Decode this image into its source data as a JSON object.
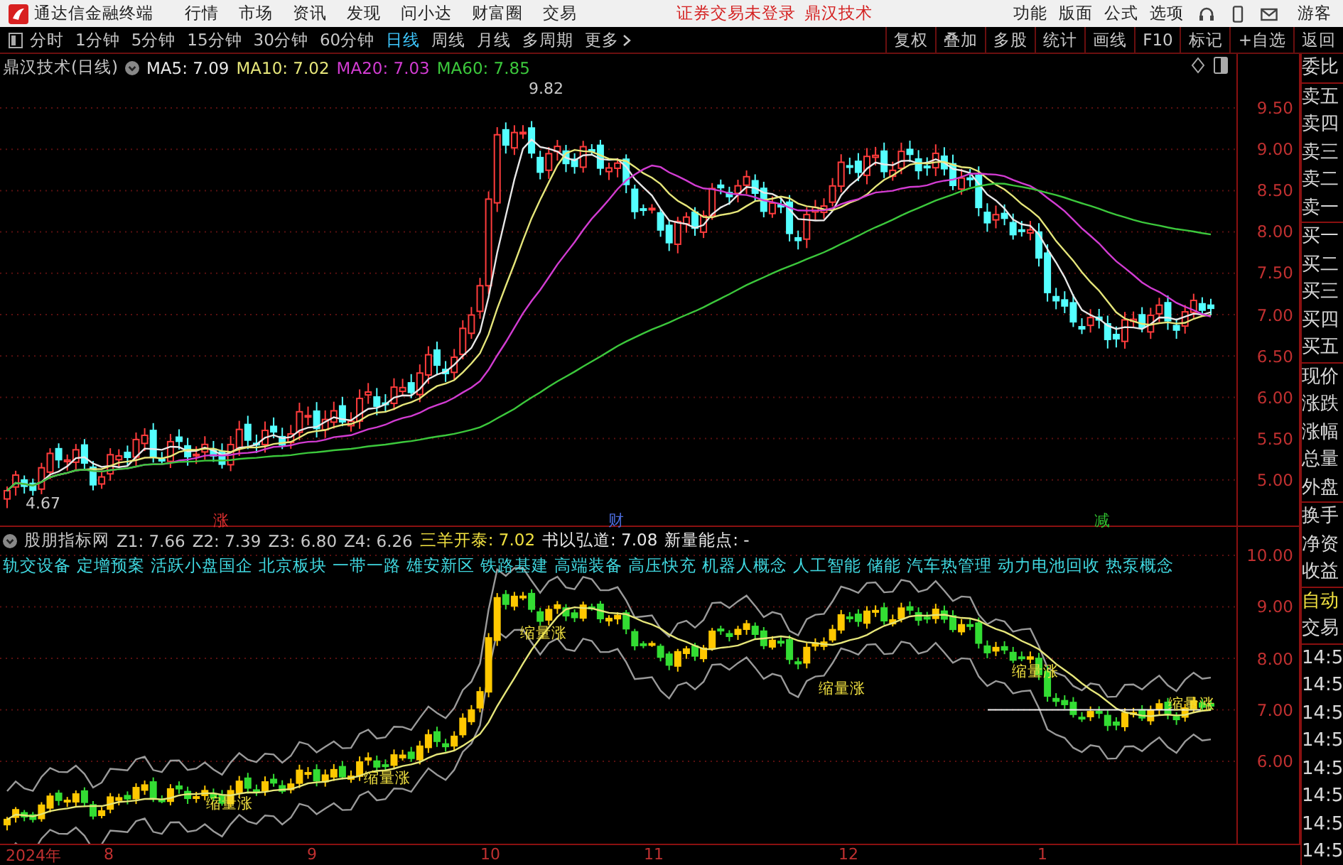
{
  "menu_bar": {
    "app_title": "通达信金融终端",
    "menus": [
      "行情",
      "市场",
      "资讯",
      "发现",
      "问小达",
      "财富圈",
      "交易"
    ],
    "notice": "证券交易未登录",
    "stock_name": "鼎汉技术",
    "right_menus": [
      "功能",
      "版面",
      "公式",
      "选项"
    ],
    "user": "游客"
  },
  "toolbar": {
    "periods": [
      {
        "label": "分时",
        "selected": false
      },
      {
        "label": "1分钟",
        "selected": false
      },
      {
        "label": "5分钟",
        "selected": false
      },
      {
        "label": "15分钟",
        "selected": false
      },
      {
        "label": "30分钟",
        "selected": false
      },
      {
        "label": "60分钟",
        "selected": false
      },
      {
        "label": "日线",
        "selected": true
      },
      {
        "label": "周线",
        "selected": false
      },
      {
        "label": "月线",
        "selected": false
      },
      {
        "label": "多周期",
        "selected": false
      }
    ],
    "more": "更多",
    "actions": [
      "复权",
      "叠加",
      "多股",
      "统计",
      "画线",
      "F10",
      "标记",
      "+自选",
      "返回"
    ]
  },
  "main_chart": {
    "title": "鼎汉技术(日线)",
    "indicators": [
      {
        "label": "MA5: 7.09",
        "color": "#e8e8e8"
      },
      {
        "label": "MA10: 7.02",
        "color": "#e6e67a"
      },
      {
        "label": "MA20: 7.03",
        "color": "#d23cd2"
      },
      {
        "label": "MA60: 7.85",
        "color": "#3cc83c"
      }
    ],
    "price_ticks": [
      "9.50",
      "9.00",
      "8.50",
      "8.00",
      "7.50",
      "7.00",
      "6.50",
      "6.00",
      "5.50",
      "5.00"
    ],
    "annotations": [
      "9.82",
      "4.67"
    ],
    "event_marks": [
      {
        "text": "涨",
        "color": "#e03030"
      },
      {
        "text": "财",
        "color": "#4a6ad8"
      },
      {
        "text": "减",
        "color": "#30c030"
      }
    ]
  },
  "indicator_chart": {
    "title": "股朋指标网",
    "values": [
      {
        "label": "Z1: 7.66",
        "color": "#c8c8c8"
      },
      {
        "label": "Z2: 7.39",
        "color": "#c8c8c8"
      },
      {
        "label": "Z3: 6.80",
        "color": "#c8c8c8"
      },
      {
        "label": "Z4: 6.26",
        "color": "#c8c8c8"
      },
      {
        "label": "三羊开泰: 7.02",
        "color": "#f0e040"
      },
      {
        "label": "书以弘道: 7.08",
        "color": "#e8e8e8"
      },
      {
        "label": "新量能点: -",
        "color": "#e8e8e8"
      }
    ],
    "concepts": [
      "轨交设备",
      "定增预案",
      "活跃小盘国企",
      "北京板块",
      "一带一路",
      "雄安新区",
      "铁路基建",
      "高端装备",
      "高压快充",
      "机器人概念",
      "人工智能",
      "储能",
      "汽车热管理",
      "动力电池回收",
      "热泵概念"
    ],
    "signal_labels": [
      "缩量涨",
      "缩量涨",
      "缩量涨",
      "缩量涨",
      "缩量涨",
      "缩量涨"
    ],
    "price_ticks": [
      "10.00",
      "9.00",
      "8.00",
      "7.00",
      "6.00"
    ]
  },
  "date_axis": [
    "2024年",
    "8",
    "9",
    "10",
    "11",
    "12",
    "1"
  ],
  "quote_panel": {
    "groups": [
      [
        "委比"
      ],
      [
        "卖五",
        "卖四",
        "卖三",
        "卖二",
        "卖一"
      ],
      [
        "买一",
        "买二",
        "买三",
        "买四",
        "买五"
      ],
      [
        "现价",
        "涨跌",
        "涨幅",
        "总量",
        "外盘"
      ],
      [
        "换手",
        "净资",
        "收益"
      ]
    ],
    "auto_trade": {
      "label": "自动",
      "on": true,
      "sub": "交易"
    },
    "times": [
      "14:5",
      "14:5",
      "14:5",
      "14:5",
      "14:5",
      "14:5",
      "14:5",
      "14:5"
    ]
  }
}
